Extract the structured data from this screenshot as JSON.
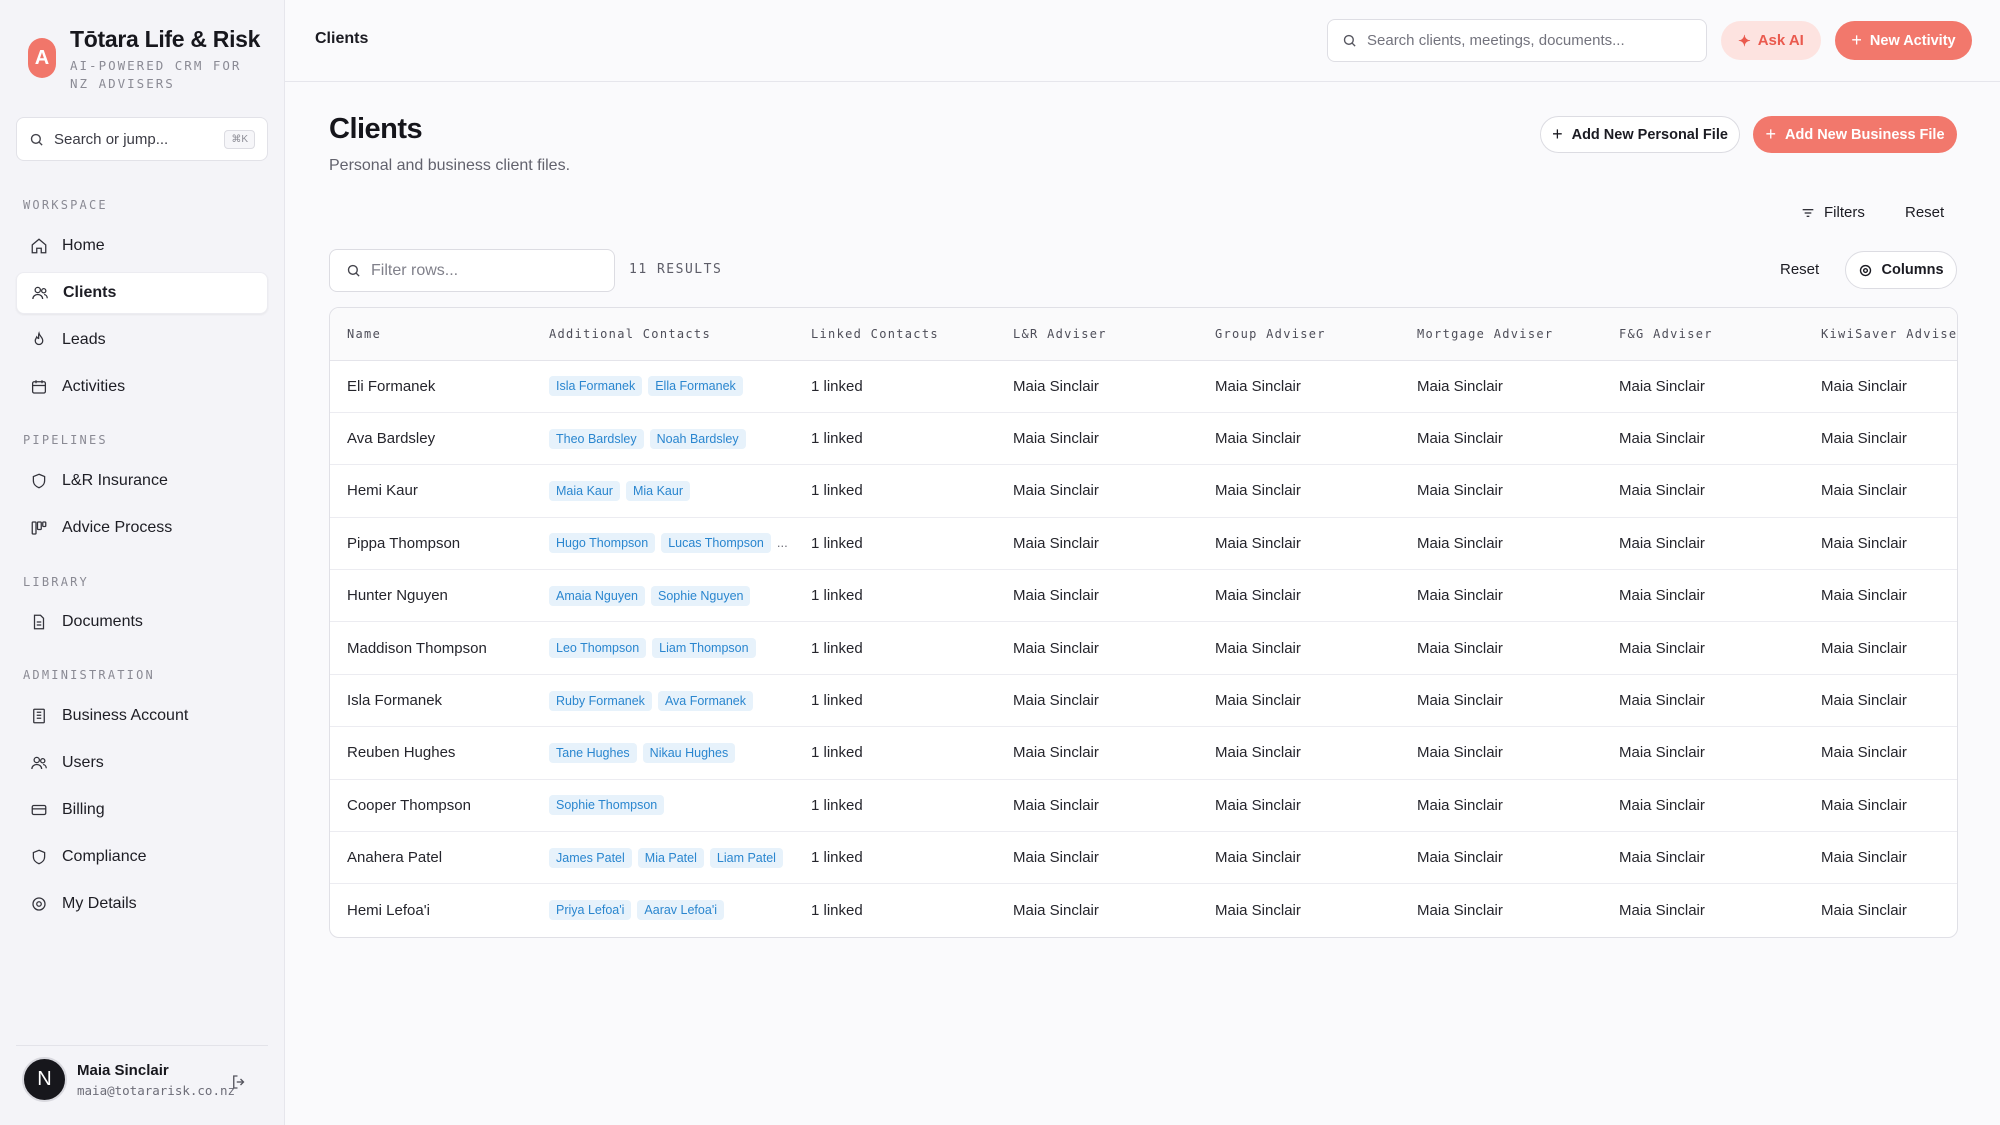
{
  "brand": {
    "logo_letter": "A",
    "name": "Tōtara Life & Risk",
    "tagline": "AI-POWERED CRM FOR NZ ADVISERS",
    "accent": "#f2786c"
  },
  "sidebar": {
    "search_placeholder": "Search or jump...",
    "shortcut": "⌘K",
    "sections": {
      "workspace": "WORKSPACE",
      "pipelines": "PIPELINES",
      "library": "LIBRARY",
      "administration": "ADMINISTRATION"
    },
    "items": [
      {
        "label": "Home",
        "icon": "home-icon"
      },
      {
        "label": "Clients",
        "icon": "users-icon",
        "active": true
      },
      {
        "label": "Leads",
        "icon": "flame-icon"
      },
      {
        "label": "Activities",
        "icon": "calendar-icon"
      },
      {
        "label": "L&R Insurance",
        "icon": "shield-icon"
      },
      {
        "label": "Advice Process",
        "icon": "workflow-icon"
      },
      {
        "label": "Documents",
        "icon": "document-icon"
      },
      {
        "label": "Business Account",
        "icon": "building-icon"
      },
      {
        "label": "Users",
        "icon": "users-icon"
      },
      {
        "label": "Billing",
        "icon": "credit-card-icon"
      },
      {
        "label": "Compliance",
        "icon": "shield-icon"
      },
      {
        "label": "My Details",
        "icon": "gear-icon"
      }
    ],
    "user": {
      "initial": "N",
      "name": "Maia Sinclair",
      "email": "maia@totararisk.co.nz"
    }
  },
  "header": {
    "breadcrumb": "Clients",
    "search_placeholder": "Search clients, meetings, documents...",
    "ask_ai_label": "Ask AI",
    "new_activity_label": "New Activity"
  },
  "main": {
    "title": "Clients",
    "subtitle": "Personal and business client files.",
    "add_personal_label": "Add New Personal File",
    "add_business_label": "Add New Business File",
    "filters_label": "Filters",
    "reset_label": "Reset",
    "filter_placeholder": "Filter rows...",
    "results_label": "11 RESULTS",
    "columns_label": "Columns"
  },
  "table": {
    "columns": [
      "Name",
      "Additional Contacts",
      "Linked Contacts",
      "L&R Adviser",
      "Group Adviser",
      "Mortgage Adviser",
      "F&G Adviser",
      "KiwiSaver Adviser"
    ],
    "rows": [
      {
        "name": "Eli Formanek",
        "contacts": [
          "Isla Formanek",
          "Ella Formanek"
        ],
        "linked": "1 linked",
        "lr": "Maia Sinclair",
        "group": "Maia Sinclair",
        "mortgage": "Maia Sinclair",
        "fg": "Maia Sinclair",
        "kiwisaver": "Maia Sinclair"
      },
      {
        "name": "Ava Bardsley",
        "contacts": [
          "Theo Bardsley",
          "Noah Bardsley"
        ],
        "linked": "1 linked",
        "lr": "Maia Sinclair",
        "group": "Maia Sinclair",
        "mortgage": "Maia Sinclair",
        "fg": "Maia Sinclair",
        "kiwisaver": "Maia Sinclair"
      },
      {
        "name": "Hemi Kaur",
        "contacts": [
          "Maia Kaur",
          "Mia Kaur"
        ],
        "linked": "1 linked",
        "lr": "Maia Sinclair",
        "group": "Maia Sinclair",
        "mortgage": "Maia Sinclair",
        "fg": "Maia Sinclair",
        "kiwisaver": "Maia Sinclair"
      },
      {
        "name": "Pippa Thompson",
        "contacts": [
          "Hugo Thompson",
          "Lucas Thompson"
        ],
        "more": "...",
        "linked": "1 linked",
        "lr": "Maia Sinclair",
        "group": "Maia Sinclair",
        "mortgage": "Maia Sinclair",
        "fg": "Maia Sinclair",
        "kiwisaver": "Maia Sinclair"
      },
      {
        "name": "Hunter Nguyen",
        "contacts": [
          "Amaia Nguyen",
          "Sophie Nguyen"
        ],
        "linked": "1 linked",
        "lr": "Maia Sinclair",
        "group": "Maia Sinclair",
        "mortgage": "Maia Sinclair",
        "fg": "Maia Sinclair",
        "kiwisaver": "Maia Sinclair"
      },
      {
        "name": "Maddison Thompson",
        "contacts": [
          "Leo Thompson",
          "Liam Thompson"
        ],
        "linked": "1 linked",
        "lr": "Maia Sinclair",
        "group": "Maia Sinclair",
        "mortgage": "Maia Sinclair",
        "fg": "Maia Sinclair",
        "kiwisaver": "Maia Sinclair"
      },
      {
        "name": "Isla Formanek",
        "contacts": [
          "Ruby Formanek",
          "Ava Formanek"
        ],
        "linked": "1 linked",
        "lr": "Maia Sinclair",
        "group": "Maia Sinclair",
        "mortgage": "Maia Sinclair",
        "fg": "Maia Sinclair",
        "kiwisaver": "Maia Sinclair"
      },
      {
        "name": "Reuben Hughes",
        "contacts": [
          "Tane Hughes",
          "Nikau Hughes"
        ],
        "linked": "1 linked",
        "lr": "Maia Sinclair",
        "group": "Maia Sinclair",
        "mortgage": "Maia Sinclair",
        "fg": "Maia Sinclair",
        "kiwisaver": "Maia Sinclair"
      },
      {
        "name": "Cooper Thompson",
        "contacts": [
          "Sophie Thompson"
        ],
        "linked": "1 linked",
        "lr": "Maia Sinclair",
        "group": "Maia Sinclair",
        "mortgage": "Maia Sinclair",
        "fg": "Maia Sinclair",
        "kiwisaver": "Maia Sinclair"
      },
      {
        "name": "Anahera Patel",
        "contacts": [
          "James Patel",
          "Mia Patel",
          "Liam Patel"
        ],
        "linked": "1 linked",
        "lr": "Maia Sinclair",
        "group": "Maia Sinclair",
        "mortgage": "Maia Sinclair",
        "fg": "Maia Sinclair",
        "kiwisaver": "Maia Sinclair"
      },
      {
        "name": "Hemi Lefoa'i",
        "contacts": [
          "Priya Lefoa'i",
          "Aarav Lefoa'i"
        ],
        "linked": "1 linked",
        "lr": "Maia Sinclair",
        "group": "Maia Sinclair",
        "mortgage": "Maia Sinclair",
        "fg": "Maia Sinclair",
        "kiwisaver": "Maia Sinclair"
      }
    ]
  }
}
